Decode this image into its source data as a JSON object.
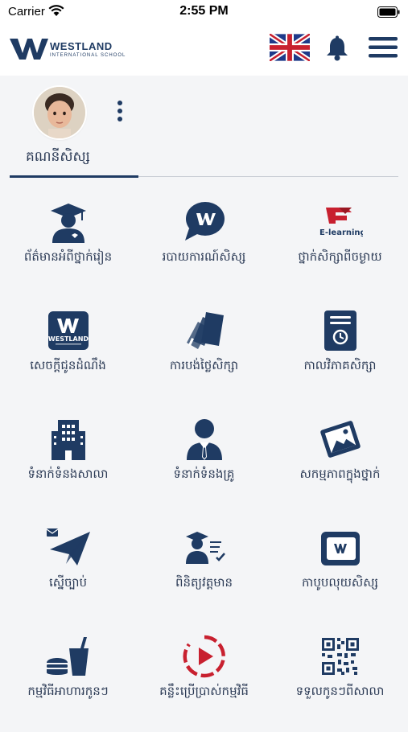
{
  "status_bar": {
    "carrier": "Carrier",
    "time": "2:55 PM"
  },
  "header": {
    "logo_name": "WESTLAND",
    "logo_subtitle": "INTERNATIONAL SCHOOL",
    "language_flag": "uk-flag-icon",
    "notification_icon": "bell-icon",
    "menu_icon": "hamburger-menu-icon"
  },
  "profile": {
    "tab_label": "គណនីសិស្ស"
  },
  "colors": {
    "primary": "#1f3b63",
    "accent_red": "#c8202f",
    "background": "#f4f5f7"
  },
  "menu_items": [
    {
      "label": "ព័ត៌មានអំពីថ្នាក់រៀន",
      "icon": "student-graduate-icon"
    },
    {
      "label": "របាយការណ៍សិស្ស",
      "icon": "speech-bubble-logo-icon"
    },
    {
      "label": "ថ្នាក់សិក្សាពីចម្ងាយ",
      "icon": "e-learning-icon",
      "icon_text": "E-learning"
    },
    {
      "label": "សេចក្តីជូនដំណឹង",
      "icon": "westland-announcement-icon",
      "icon_text": "WESTLAND"
    },
    {
      "label": "ការបង់ថ្លៃសិក្សា",
      "icon": "payment-cards-icon"
    },
    {
      "label": "កាលវិភាគសិក្សា",
      "icon": "schedule-book-icon"
    },
    {
      "label": "ទំនាក់ទំនងសាលា",
      "icon": "school-building-icon"
    },
    {
      "label": "ទំនាក់ទំនងគ្រូ",
      "icon": "teacher-icon"
    },
    {
      "label": "សកម្មភាពក្នុងថ្នាក់",
      "icon": "class-activity-photo-icon"
    },
    {
      "label": "ស្នើច្បាប់",
      "icon": "paper-plane-icon"
    },
    {
      "label": "ពិនិត្យវត្តមាន",
      "icon": "attendance-icon"
    },
    {
      "label": "កាបូបលុយសិស្ស",
      "icon": "student-wallet-icon"
    },
    {
      "label": "កម្មវិធីអាហារកូនៗ",
      "icon": "food-drink-icon"
    },
    {
      "label": "គន្លឹះប្រើប្រាស់កម្មវិធី",
      "icon": "play-tutorial-icon"
    },
    {
      "label": "ទទួលកូនៗពីសាលា",
      "icon": "qr-code-icon"
    }
  ]
}
